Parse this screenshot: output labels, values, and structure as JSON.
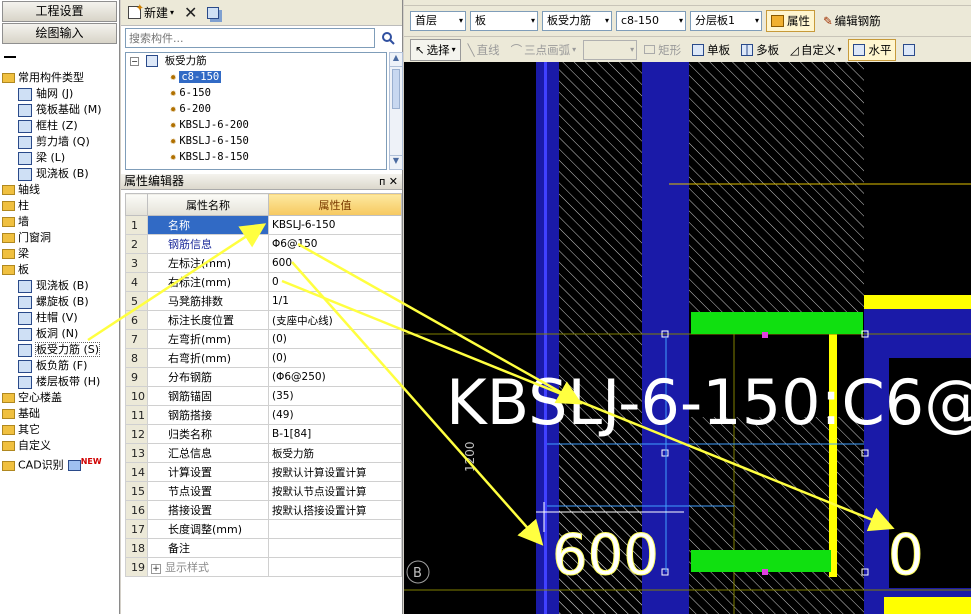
{
  "nav": {
    "buttons": [
      "工程设置",
      "绘图输入"
    ],
    "tree": [
      {
        "label": "常用构件类型",
        "level": 0,
        "kind": "folder"
      },
      {
        "label": "轴网 (J)",
        "level": 1,
        "kind": "item",
        "icon": "grid-icon"
      },
      {
        "label": "筏板基础 (M)",
        "level": 1,
        "kind": "item",
        "icon": "raft-foundation-icon"
      },
      {
        "label": "框柱 (Z)",
        "level": 1,
        "kind": "item",
        "icon": "column-icon"
      },
      {
        "label": "剪力墙 (Q)",
        "level": 1,
        "kind": "item",
        "icon": "shear-wall-icon"
      },
      {
        "label": "梁 (L)",
        "level": 1,
        "kind": "item",
        "icon": "beam-icon"
      },
      {
        "label": "现浇板 (B)",
        "level": 1,
        "kind": "item",
        "icon": "slab-icon"
      },
      {
        "label": "轴线",
        "level": 0,
        "kind": "folder"
      },
      {
        "label": "柱",
        "level": 0,
        "kind": "folder"
      },
      {
        "label": "墙",
        "level": 0,
        "kind": "folder"
      },
      {
        "label": "门窗洞",
        "level": 0,
        "kind": "folder"
      },
      {
        "label": "梁",
        "level": 0,
        "kind": "folder"
      },
      {
        "label": "板",
        "level": 0,
        "kind": "folder"
      },
      {
        "label": "现浇板 (B)",
        "level": 1,
        "kind": "item",
        "icon": "slab-icon"
      },
      {
        "label": "螺旋板 (B)",
        "level": 1,
        "kind": "item",
        "icon": "spiral-slab-icon"
      },
      {
        "label": "柱帽 (V)",
        "level": 1,
        "kind": "item",
        "icon": "column-cap-icon"
      },
      {
        "label": "板洞 (N)",
        "level": 1,
        "kind": "item",
        "icon": "slab-hole-icon"
      },
      {
        "label": "板受力筋 (S)",
        "level": 1,
        "kind": "item",
        "icon": "slab-rebar-icon",
        "selected": true
      },
      {
        "label": "板负筋 (F)",
        "level": 1,
        "kind": "item",
        "icon": "negative-rebar-icon"
      },
      {
        "label": "楼层板带 (H)",
        "level": 1,
        "kind": "item",
        "icon": "slab-band-icon"
      },
      {
        "label": "空心楼盖",
        "level": 0,
        "kind": "folder"
      },
      {
        "label": "基础",
        "level": 0,
        "kind": "folder"
      },
      {
        "label": "其它",
        "level": 0,
        "kind": "folder"
      },
      {
        "label": "自定义",
        "level": 0,
        "kind": "folder"
      },
      {
        "label": "CAD识别",
        "level": 0,
        "kind": "folder",
        "badge": "NEW"
      }
    ]
  },
  "components": {
    "toolbar": {
      "new_label": "新建"
    },
    "search": {
      "placeholder": "搜索构件..."
    },
    "root": "板受力筋",
    "items": [
      "c8-150",
      "6-150",
      "6-200",
      "KBSLJ-6-200",
      "KBSLJ-6-150",
      "KBSLJ-8-150"
    ],
    "selected_index": 0
  },
  "props": {
    "title": "属性编辑器",
    "title_buttons": "ᴨ ✕",
    "col_name": "属性名称",
    "col_value": "属性值",
    "rows": [
      {
        "n": "1",
        "name": "名称",
        "value": "KBSLJ-6-150",
        "blue": true,
        "hl": true
      },
      {
        "n": "2",
        "name": "钢筋信息",
        "value": "Φ6@150",
        "blue": true
      },
      {
        "n": "3",
        "name": "左标注(mm)",
        "value": "600"
      },
      {
        "n": "4",
        "name": "右标注(mm)",
        "value": "0"
      },
      {
        "n": "5",
        "name": "马凳筋排数",
        "value": "1/1"
      },
      {
        "n": "6",
        "name": "标注长度位置",
        "value": "(支座中心线)"
      },
      {
        "n": "7",
        "name": "左弯折(mm)",
        "value": "(0)"
      },
      {
        "n": "8",
        "name": "右弯折(mm)",
        "value": "(0)"
      },
      {
        "n": "9",
        "name": "分布钢筋",
        "value": "(Φ6@250)"
      },
      {
        "n": "10",
        "name": "钢筋锚固",
        "value": "(35)"
      },
      {
        "n": "11",
        "name": "钢筋搭接",
        "value": "(49)"
      },
      {
        "n": "12",
        "name": "归类名称",
        "value": "B-1[84]"
      },
      {
        "n": "13",
        "name": "汇总信息",
        "value": "板受力筋"
      },
      {
        "n": "14",
        "name": "计算设置",
        "value": "按默认计算设置计算"
      },
      {
        "n": "15",
        "name": "节点设置",
        "value": "按默认节点设置计算"
      },
      {
        "n": "16",
        "name": "搭接设置",
        "value": "按默认搭接设置计算"
      },
      {
        "n": "17",
        "name": "长度调整(mm)",
        "value": ""
      },
      {
        "n": "18",
        "name": "备注",
        "value": ""
      },
      {
        "n": "19",
        "name": "显示样式",
        "value": "",
        "gray": true,
        "expand": "+"
      }
    ]
  },
  "draw": {
    "floor": "首层",
    "category": "板",
    "type": "板受力筋",
    "component": "c8-150",
    "layer": "分层板1",
    "attr_label": "属性",
    "edit_rebar_label": "编辑钢筋",
    "select_label": "选择",
    "line_label": "直线",
    "arc_label": "三点画弧",
    "rect_label": "矩形",
    "single_label": "单板",
    "multi_label": "多板",
    "custom_label": "自定义",
    "horizontal_label": "水平"
  },
  "canvas": {
    "big_label": "KBSLJ-6-150:C6@",
    "left_dim": "600",
    "right_dim": "0",
    "vertical_dim": "1200",
    "axis_label": "B",
    "colors": {
      "wall": "#1a1aa8",
      "beam": "#ffff00",
      "support": "#10e010",
      "hatch": "#d0d0d0",
      "arrow": "#ffff40"
    }
  }
}
